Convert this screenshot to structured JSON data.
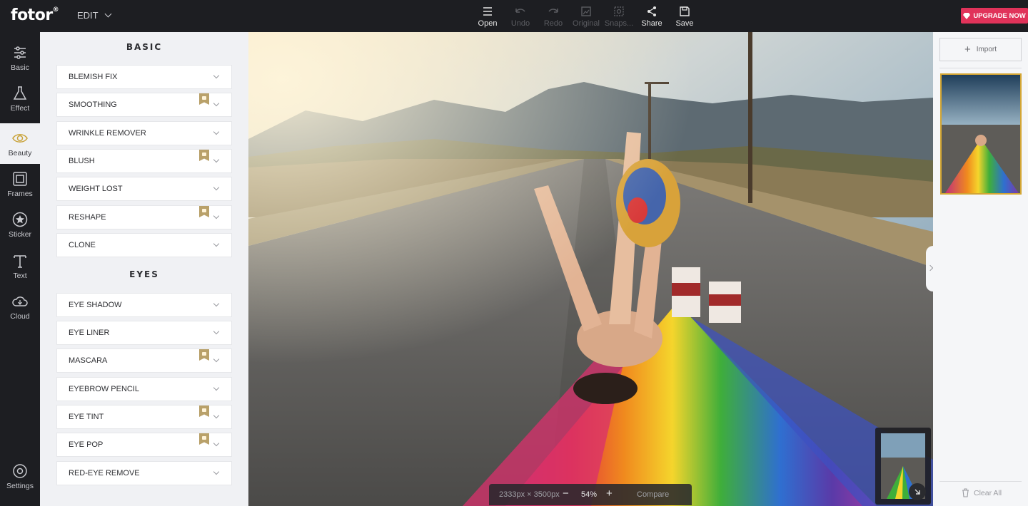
{
  "app": {
    "logo": "fotor",
    "logo_mark": "®"
  },
  "topbar": {
    "edit_label": "EDIT",
    "tools": [
      {
        "label": "Open",
        "icon": "menu-icon",
        "enabled": true
      },
      {
        "label": "Undo",
        "icon": "undo-icon",
        "enabled": false
      },
      {
        "label": "Redo",
        "icon": "redo-icon",
        "enabled": false
      },
      {
        "label": "Original",
        "icon": "original-icon",
        "enabled": false
      },
      {
        "label": "Snaps...",
        "icon": "snapshot-icon",
        "enabled": false
      },
      {
        "label": "Share",
        "icon": "share-icon",
        "enabled": true
      },
      {
        "label": "Save",
        "icon": "save-icon",
        "enabled": true
      }
    ],
    "upgrade_label": "UPGRADE NOW"
  },
  "rail": {
    "items": [
      {
        "label": "Basic",
        "icon": "sliders-icon"
      },
      {
        "label": "Effect",
        "icon": "flask-icon"
      },
      {
        "label": "Beauty",
        "icon": "eye-icon",
        "active": true
      },
      {
        "label": "Frames",
        "icon": "frame-icon"
      },
      {
        "label": "Sticker",
        "icon": "star-circle-icon"
      },
      {
        "label": "Text",
        "icon": "text-icon"
      },
      {
        "label": "Cloud",
        "icon": "cloud-icon"
      }
    ],
    "settings_label": "Settings"
  },
  "panel": {
    "basic_title": "BASIC",
    "basic_items": [
      {
        "label": "BLEMISH FIX",
        "premium": false
      },
      {
        "label": "SMOOTHING",
        "premium": true
      },
      {
        "label": "WRINKLE REMOVER",
        "premium": false
      },
      {
        "label": "BLUSH",
        "premium": true
      },
      {
        "label": "WEIGHT LOST",
        "premium": false
      },
      {
        "label": "RESHAPE",
        "premium": true
      },
      {
        "label": "CLONE",
        "premium": false
      }
    ],
    "eyes_title": "EYES",
    "eyes_items": [
      {
        "label": "EYE SHADOW",
        "premium": false
      },
      {
        "label": "EYE LINER",
        "premium": false
      },
      {
        "label": "MASCARA",
        "premium": true
      },
      {
        "label": "EYEBROW PENCIL",
        "premium": false
      },
      {
        "label": "EYE TINT",
        "premium": true
      },
      {
        "label": "EYE POP",
        "premium": true
      },
      {
        "label": "RED-EYE REMOVE",
        "premium": false
      }
    ]
  },
  "canvas": {
    "dimensions": "2333px × 3500px",
    "zoom": "54%",
    "compare_label": "Compare"
  },
  "right_panel": {
    "import_label": "Import",
    "clear_all_label": "Clear All"
  },
  "colors": {
    "accent": "#e0335a",
    "selected_border": "#d3a533",
    "dark_bg": "#1d1e22",
    "panel_bg": "#f0f1f4",
    "premium_badge": "#b9a16a"
  }
}
